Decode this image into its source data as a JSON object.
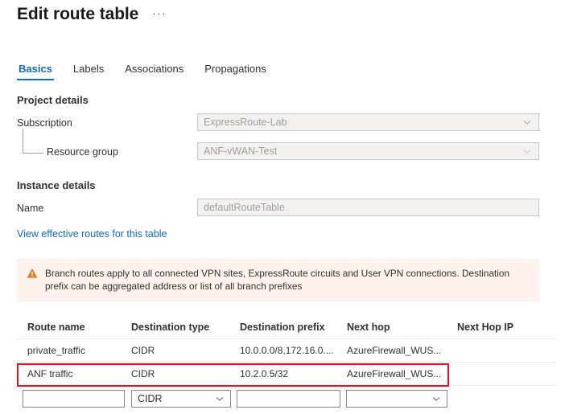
{
  "header": {
    "title": "Edit route table",
    "more_menu": "···",
    "more_menu_icon": "ellipsis-icon"
  },
  "tabs": [
    {
      "label": "Basics",
      "active": true
    },
    {
      "label": "Labels",
      "active": false
    },
    {
      "label": "Associations",
      "active": false
    },
    {
      "label": "Propagations",
      "active": false
    }
  ],
  "project_details": {
    "heading": "Project details",
    "subscription": {
      "label": "Subscription",
      "value": "ExpressRoute-Lab",
      "icon": "chevron-down-icon",
      "disabled": true
    },
    "resource_group": {
      "label": "Resource group",
      "value": "ANF-vWAN-Test",
      "icon": "chevron-down-icon",
      "disabled": true
    }
  },
  "instance_details": {
    "heading": "Instance details",
    "name": {
      "label": "Name",
      "value": "defaultRouteTable",
      "disabled": true
    },
    "effective_routes_link": "View effective routes for this table"
  },
  "warning_banner": {
    "icon": "warning-triangle-icon",
    "text": "Branch routes apply to all connected VPN sites, ExpressRoute circuits and User VPN connections. Destination prefix can be aggregated address or list of all branch prefixes",
    "background_color": "#fdf3ec",
    "icon_color": "#d87d28"
  },
  "routes_table": {
    "columns": [
      "Route name",
      "Destination type",
      "Destination prefix",
      "Next hop",
      "Next Hop IP"
    ],
    "rows": [
      {
        "route_name": "private_traffic",
        "destination_type": "CIDR",
        "destination_prefix": "10.0.0.0/8,172.16.0....",
        "next_hop": "AzureFirewall_WUS...",
        "next_hop_ip": "",
        "highlighted": false
      },
      {
        "route_name": "ANF traffic",
        "destination_type": "CIDR",
        "destination_prefix": "10.2.0.5/32",
        "next_hop": "AzureFirewall_WUS...",
        "next_hop_ip": "",
        "highlighted": true
      }
    ],
    "highlight_color": "#e81123"
  },
  "new_route_row": {
    "route_name": {
      "value": "",
      "placeholder": ""
    },
    "destination_type": {
      "value": "CIDR",
      "icon": "chevron-down-icon"
    },
    "destination_prefix": {
      "value": "",
      "placeholder": ""
    },
    "next_hop": {
      "value": "",
      "icon": "chevron-down-icon"
    }
  },
  "theme": {
    "accent": "#0f6cbd",
    "link": "#0f6cbd",
    "text": "#323130",
    "disabled_bg": "#f3f2f1",
    "border": "#c8c6c4"
  }
}
